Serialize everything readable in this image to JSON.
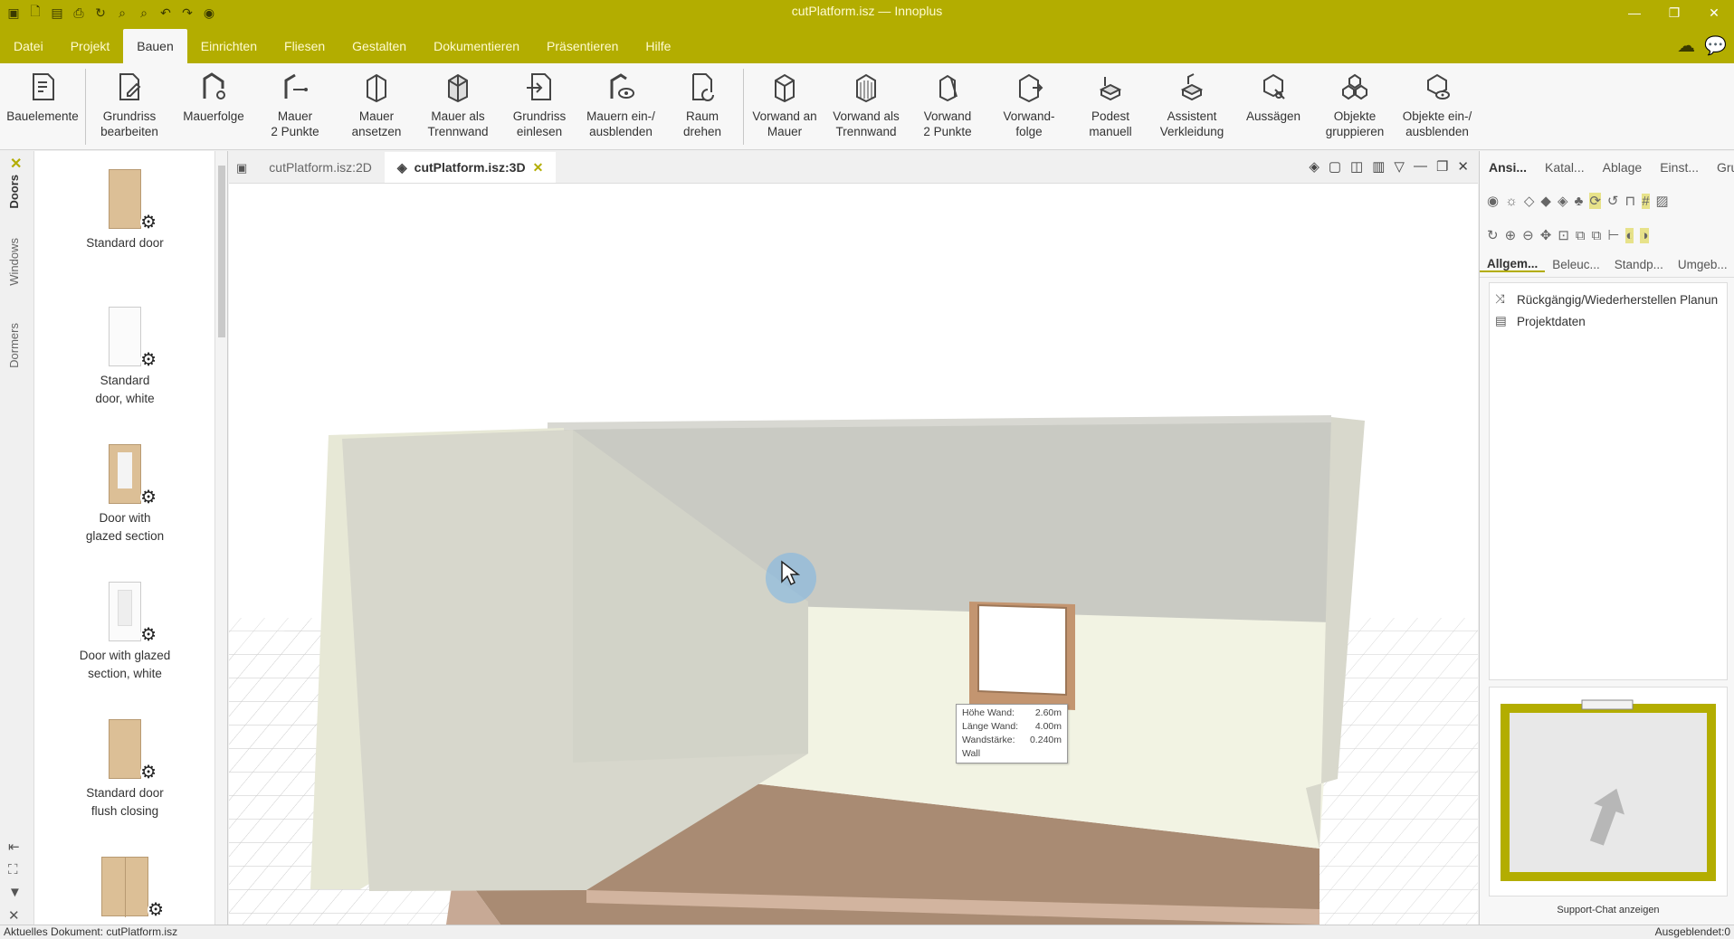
{
  "app": {
    "window_title": "cutPlatform.isz — Innoplus",
    "colors": {
      "accent": "#b3ad00",
      "floor": "#a98b73",
      "wall": "#f2f3e3",
      "door_wood": "#dcbf96"
    }
  },
  "menu": {
    "tabs": [
      "Datei",
      "Projekt",
      "Bauen",
      "Einrichten",
      "Fliesen",
      "Gestalten",
      "Dokumentieren",
      "Präsentieren",
      "Hilfe"
    ],
    "active": "Bauen"
  },
  "ribbon": {
    "b0": {
      "l1": "Bauelemente",
      "l2": "",
      "icon": "building-elements-icon"
    },
    "b1": {
      "l1": "Grundriss",
      "l2": "bearbeiten",
      "icon": "edit-floorplan-icon"
    },
    "b2": {
      "l1": "Mauerfolge",
      "l2": "",
      "icon": "wall-sequence-icon"
    },
    "b3": {
      "l1": "Mauer",
      "l2": "2 Punkte",
      "icon": "wall-2-points-icon"
    },
    "b4": {
      "l1": "Mauer",
      "l2": "ansetzen",
      "icon": "attach-wall-icon"
    },
    "b5": {
      "l1": "Mauer als",
      "l2": "Trennwand",
      "icon": "partition-wall-icon"
    },
    "b6": {
      "l1": "Grundriss",
      "l2": "einlesen",
      "icon": "import-floorplan-icon"
    },
    "b7": {
      "l1": "Mauern ein-/",
      "l2": "ausblenden",
      "icon": "toggle-walls-icon"
    },
    "b8": {
      "l1": "Raum",
      "l2": "drehen",
      "icon": "rotate-room-icon"
    },
    "b9": {
      "l1": "Vorwand an",
      "l2": "Mauer",
      "icon": "front-wall-icon"
    },
    "b10": {
      "l1": "Vorwand als",
      "l2": "Trennwand",
      "icon": "front-wall-partition-icon"
    },
    "b11": {
      "l1": "Vorwand",
      "l2": "2 Punkte",
      "icon": "front-wall-2-points-icon"
    },
    "b12": {
      "l1": "Vorwand-",
      "l2": "folge",
      "icon": "front-wall-sequence-icon"
    },
    "b13": {
      "l1": "Podest",
      "l2": "manuell",
      "icon": "platform-icon"
    },
    "b14": {
      "l1": "Assistent",
      "l2": "Verkleidung",
      "icon": "cladding-assistant-icon"
    },
    "b15": {
      "l1": "Aussägen",
      "l2": "",
      "icon": "saw-cut-icon"
    },
    "b16": {
      "l1": "Objekte",
      "l2": "gruppieren",
      "icon": "group-objects-icon"
    },
    "b17": {
      "l1": "Objekte ein-/",
      "l2": "ausblenden",
      "icon": "toggle-objects-icon"
    }
  },
  "side_tabs": {
    "doors": "Doors",
    "windows": "Windows",
    "dormers": "Dormers"
  },
  "catalog": {
    "i0": {
      "l1": "Standard door",
      "l2": ""
    },
    "i1": {
      "l1": "Standard",
      "l2": "door, white"
    },
    "i2": {
      "l1": "Door with",
      "l2": "glazed section"
    },
    "i3": {
      "l1": "Door with glazed",
      "l2": "section, white"
    },
    "i4": {
      "l1": "Standard door",
      "l2": "flush closing"
    }
  },
  "doc_tabs": {
    "t2d": "cutPlatform.isz:2D",
    "t3d": "cutPlatform.isz:3D"
  },
  "tooltip": {
    "r0": {
      "k": "Höhe Wand:",
      "v": "2.60m"
    },
    "r1": {
      "k": "Länge Wand:",
      "v": "4.00m"
    },
    "r2": {
      "k": "Wandstärke:",
      "v": "0.240m"
    },
    "type": "Wall"
  },
  "right_panel": {
    "tabs": [
      "Ansi...",
      "Katal...",
      "Ablage",
      "Einst...",
      "Grup..."
    ],
    "subtabs": [
      "Allgem...",
      "Beleuc...",
      "Standp...",
      "Umgeb..."
    ],
    "tree": [
      "Rückgängig/Wiederherstellen Planun",
      "Projektdaten"
    ],
    "support": "Support-Chat anzeigen"
  },
  "status": {
    "left": "Aktuelles Dokument: cutPlatform.isz",
    "right": "Ausgeblendet:0"
  }
}
